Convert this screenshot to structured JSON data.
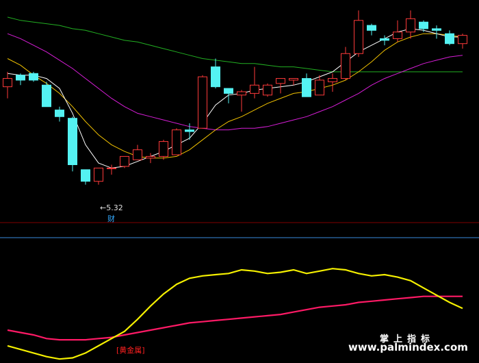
{
  "chart_data": {
    "type": "candlestick",
    "main": {
      "price_range": [
        5.12,
        6.4
      ],
      "candles": [
        {
          "open": 5.91,
          "high": 6.0,
          "low": 5.84,
          "close": 5.96
        },
        {
          "open": 5.98,
          "high": 5.99,
          "low": 5.92,
          "close": 5.95
        },
        {
          "open": 5.99,
          "high": 6.0,
          "low": 5.94,
          "close": 5.95
        },
        {
          "open": 5.92,
          "high": 5.94,
          "low": 5.79,
          "close": 5.79
        },
        {
          "open": 5.77,
          "high": 5.79,
          "low": 5.7,
          "close": 5.73
        },
        {
          "open": 5.72,
          "high": 5.73,
          "low": 5.4,
          "close": 5.44
        },
        {
          "open": 5.41,
          "high": 5.41,
          "low": 5.32,
          "close": 5.34
        },
        {
          "open": 5.34,
          "high": 5.42,
          "low": 5.32,
          "close": 5.42
        },
        {
          "open": 5.42,
          "high": 5.44,
          "low": 5.38,
          "close": 5.42
        },
        {
          "open": 5.43,
          "high": 5.49,
          "low": 5.42,
          "close": 5.49
        },
        {
          "open": 5.47,
          "high": 5.56,
          "low": 5.47,
          "close": 5.53
        },
        {
          "open": 5.48,
          "high": 5.51,
          "low": 5.45,
          "close": 5.49
        },
        {
          "open": 5.49,
          "high": 5.59,
          "low": 5.47,
          "close": 5.58
        },
        {
          "open": 5.5,
          "high": 5.66,
          "low": 5.5,
          "close": 5.65
        },
        {
          "open": 5.65,
          "high": 5.69,
          "low": 5.59,
          "close": 5.64
        },
        {
          "open": 5.66,
          "high": 5.98,
          "low": 5.66,
          "close": 5.97
        },
        {
          "open": 6.03,
          "high": 6.08,
          "low": 5.9,
          "close": 5.91
        },
        {
          "open": 5.9,
          "high": 5.9,
          "low": 5.81,
          "close": 5.87
        },
        {
          "open": 5.86,
          "high": 5.89,
          "low": 5.76,
          "close": 5.88
        },
        {
          "open": 5.87,
          "high": 6.03,
          "low": 5.84,
          "close": 5.92
        },
        {
          "open": 5.86,
          "high": 5.93,
          "low": 5.85,
          "close": 5.92
        },
        {
          "open": 5.93,
          "high": 5.95,
          "low": 5.87,
          "close": 5.96
        },
        {
          "open": 5.95,
          "high": 5.96,
          "low": 5.92,
          "close": 5.96
        },
        {
          "open": 5.96,
          "high": 5.99,
          "low": 5.85,
          "close": 5.85
        },
        {
          "open": 5.86,
          "high": 5.98,
          "low": 5.86,
          "close": 5.95
        },
        {
          "open": 5.94,
          "high": 5.99,
          "low": 5.88,
          "close": 5.96
        },
        {
          "open": 5.96,
          "high": 6.15,
          "low": 5.95,
          "close": 6.11
        },
        {
          "open": 6.11,
          "high": 6.37,
          "low": 6.09,
          "close": 6.31
        },
        {
          "open": 6.28,
          "high": 6.29,
          "low": 6.22,
          "close": 6.25
        },
        {
          "open": 6.2,
          "high": 6.22,
          "low": 6.16,
          "close": 6.19
        },
        {
          "open": 6.2,
          "high": 6.31,
          "low": 6.18,
          "close": 6.24
        },
        {
          "open": 6.24,
          "high": 6.37,
          "low": 6.2,
          "close": 6.32
        },
        {
          "open": 6.3,
          "high": 6.31,
          "low": 6.24,
          "close": 6.26
        },
        {
          "open": 6.26,
          "high": 6.28,
          "low": 6.2,
          "close": 6.25
        },
        {
          "open": 6.23,
          "high": 6.25,
          "low": 6.16,
          "close": 6.17
        },
        {
          "open": 6.17,
          "high": 6.23,
          "low": 6.14,
          "close": 6.22
        }
      ],
      "ma_white": [
        5.99,
        5.98,
        5.98,
        5.96,
        5.9,
        5.75,
        5.56,
        5.45,
        5.42,
        5.43,
        5.46,
        5.49,
        5.52,
        5.56,
        5.6,
        5.69,
        5.8,
        5.86,
        5.87,
        5.89,
        5.9,
        5.91,
        5.92,
        5.94,
        5.97,
        6.0,
        6.06,
        6.12,
        6.16,
        6.2,
        6.24,
        6.26,
        6.25,
        6.23,
        6.21,
        6.21
      ],
      "ma_yellow": [
        6.08,
        6.04,
        5.98,
        5.93,
        5.87,
        5.79,
        5.7,
        5.62,
        5.56,
        5.52,
        5.49,
        5.48,
        5.48,
        5.49,
        5.53,
        5.59,
        5.65,
        5.7,
        5.73,
        5.77,
        5.81,
        5.84,
        5.87,
        5.88,
        5.9,
        5.92,
        5.95,
        6.0,
        6.06,
        6.13,
        6.18,
        6.21,
        6.23,
        6.23,
        6.22,
        6.21
      ],
      "ma_purple": [
        6.23,
        6.2,
        6.16,
        6.12,
        6.07,
        6.02,
        5.96,
        5.9,
        5.84,
        5.79,
        5.75,
        5.73,
        5.71,
        5.69,
        5.67,
        5.66,
        5.65,
        5.65,
        5.66,
        5.66,
        5.67,
        5.69,
        5.71,
        5.73,
        5.76,
        5.79,
        5.83,
        5.87,
        5.92,
        5.96,
        5.99,
        6.02,
        6.05,
        6.07,
        6.09,
        6.1
      ],
      "ma_green": [
        6.33,
        6.31,
        6.3,
        6.29,
        6.28,
        6.26,
        6.25,
        6.23,
        6.21,
        6.19,
        6.18,
        6.16,
        6.14,
        6.12,
        6.1,
        6.08,
        6.07,
        6.06,
        6.05,
        6.05,
        6.04,
        6.03,
        6.03,
        6.02,
        6.01,
        6.0,
        6.0,
        6.0,
        6.0,
        6.0,
        6.0,
        6.0,
        6.0,
        6.0,
        6.0,
        6.0
      ],
      "low_marker": {
        "value": "5.32",
        "tag": "财"
      }
    },
    "indicator": {
      "range": [
        0,
        100
      ],
      "yellow": [
        12,
        9,
        6,
        3,
        1,
        2,
        6,
        12,
        18,
        24,
        34,
        45,
        55,
        63,
        68,
        70,
        71,
        72,
        75,
        74,
        72,
        73,
        75,
        72,
        74,
        76,
        75,
        72,
        70,
        71,
        69,
        66,
        60,
        54,
        48,
        43
      ],
      "magenta": [
        25,
        23,
        21,
        18,
        17,
        17,
        17,
        18,
        19,
        21,
        23,
        25,
        27,
        29,
        31,
        32,
        33,
        34,
        35,
        36,
        37,
        38,
        40,
        42,
        44,
        45,
        46,
        48,
        49,
        50,
        51,
        52,
        53,
        53,
        53,
        53
      ]
    },
    "indicator_tag": "[黄金属]",
    "colors": {
      "up": "#ff3a3a",
      "down": "#54f2f2",
      "ma_white": "#ffffff",
      "ma_yellow": "#f2c200",
      "ma_purple": "#d81ed8",
      "ma_green": "#22b022",
      "ind_yellow": "#f5f000",
      "ind_magenta": "#ff1a66",
      "separator": "#800000",
      "sub_line": "#3a8dde"
    }
  },
  "watermark": {
    "cn": "掌上指标",
    "url": "www.palmindex.com"
  }
}
